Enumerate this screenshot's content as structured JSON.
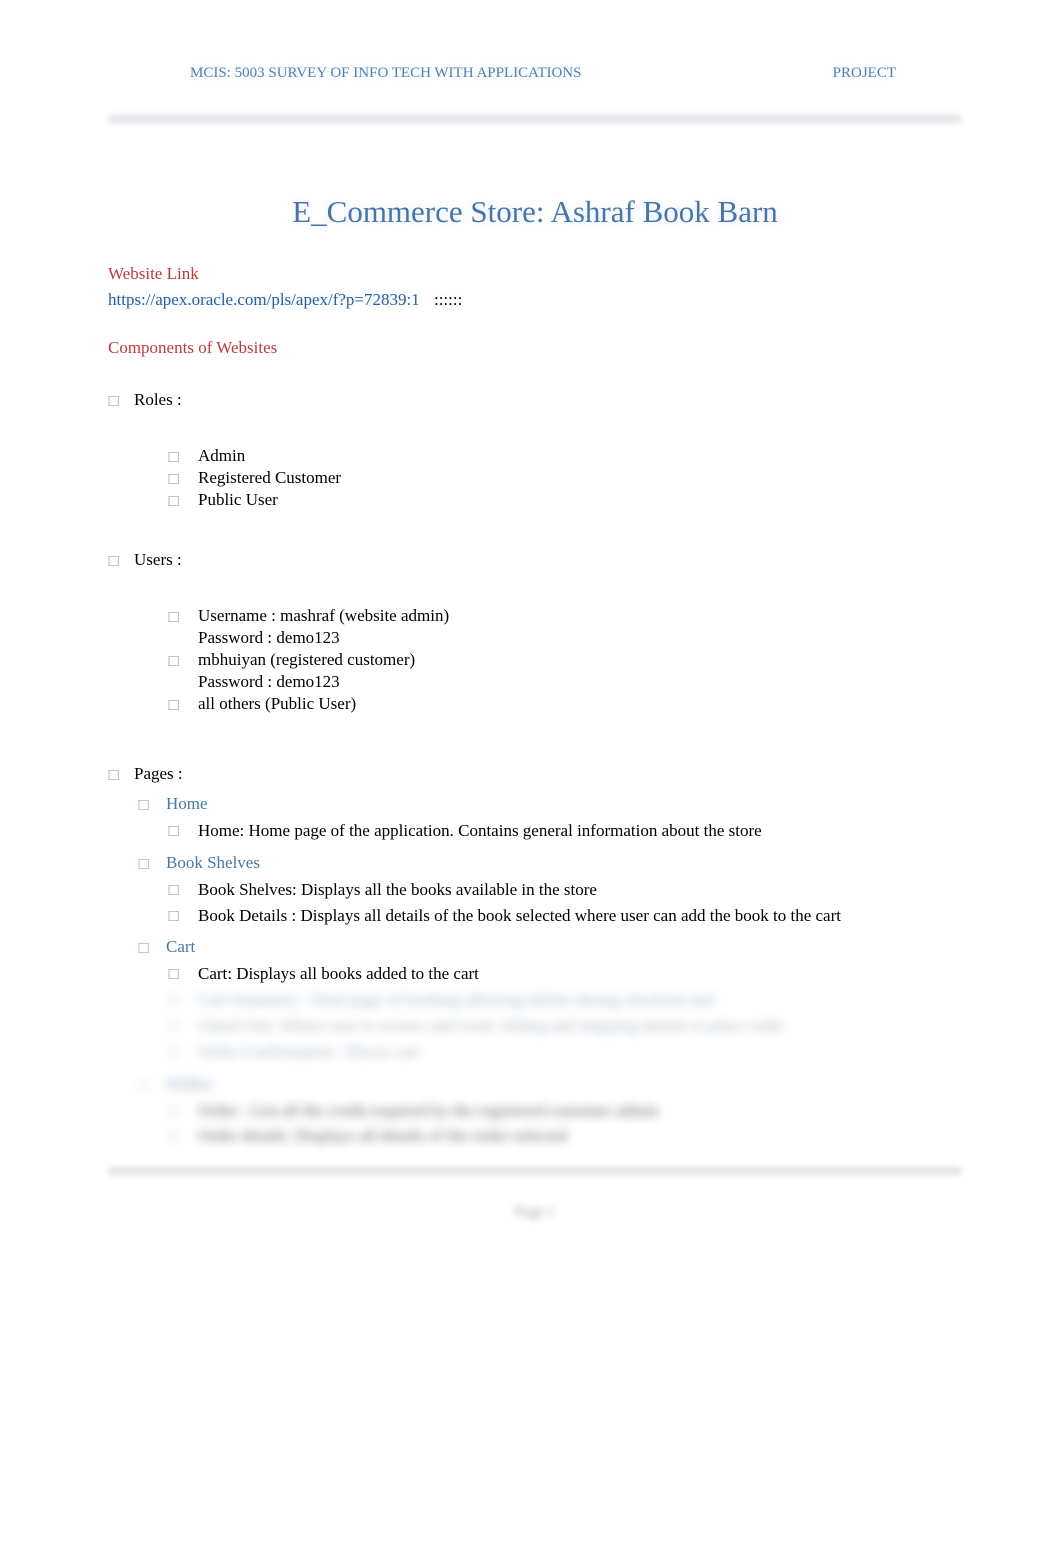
{
  "header": {
    "course": "MCIS: 5003 SURVEY OF INFO TECH WITH APPLICATIONS",
    "label": "PROJECT"
  },
  "title": "E_Commerce Store: Ashraf Book Barn",
  "website_link_label": "Website Link",
  "website_url": "https://apex.oracle.com/pls/apex/f?p=72839:1",
  "website_url_suffix": "::::::",
  "components_label": "Components of Websites",
  "roles": {
    "heading": "Roles :",
    "items": [
      "Admin",
      "Registered Customer",
      "Public User"
    ]
  },
  "users": {
    "heading": "Users :",
    "entries": [
      {
        "line1": "Username  :        mashraf   (website admin)",
        "line2": "Password   :        demo123"
      },
      {
        "line1": "mbhuiyan   (registered customer)",
        "line2": "Password    :         demo123"
      },
      {
        "line1": "all others    (Public User)"
      }
    ]
  },
  "pages": {
    "heading": "Pages :",
    "sections": [
      {
        "title": "Home",
        "items": [
          "Home:  Home page of the application. Contains general information about the store"
        ]
      },
      {
        "title": "Book Shelves",
        "items": [
          "Book Shelves: Displays all the books available in the store",
          "Book Details : Displays all details of the book selected where user can add the book to the cart"
        ]
      },
      {
        "title": "Cart",
        "items": [
          "Cart: Displays all books added to the cart"
        ],
        "blurred_items": [
          "Cart Summary : Final page of booking allowing define during checkout and",
          "Check Out: Where user to review and work. billing and shipping details to place order",
          "Order Confirmation : Places cart"
        ]
      },
      {
        "title": "Orders",
        "blurred": true,
        "items": [
          "Order : List all the credit required by the registered customer admin",
          "Order details: Displays all details of the order selected"
        ]
      }
    ]
  },
  "footer": {
    "page_label": "Page 1"
  }
}
